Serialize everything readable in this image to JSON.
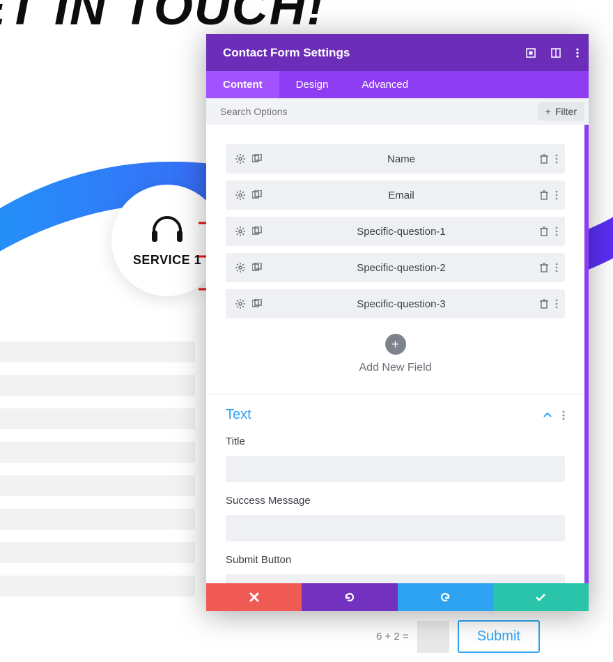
{
  "bg_heading": "ET IN TOUCH!",
  "service": {
    "label": "SERVICE 1"
  },
  "captcha": {
    "question": "6 + 2 =",
    "submit": "Submit"
  },
  "modal": {
    "title": "Contact Form Settings",
    "tabs": {
      "content": "Content",
      "design": "Design",
      "advanced": "Advanced"
    },
    "search_placeholder": "Search Options",
    "filter_label": "Filter",
    "fields": [
      {
        "label": "Name"
      },
      {
        "label": "Email"
      },
      {
        "label": "Specific-question-1"
      },
      {
        "label": "Specific-question-2"
      },
      {
        "label": "Specific-question-3"
      }
    ],
    "add_label": "Add New Field",
    "text_section": {
      "heading": "Text",
      "title_label": "Title",
      "success_label": "Success Message",
      "submit_label": "Submit Button"
    }
  },
  "colors": {
    "purple": "#6c2eb9"
  }
}
